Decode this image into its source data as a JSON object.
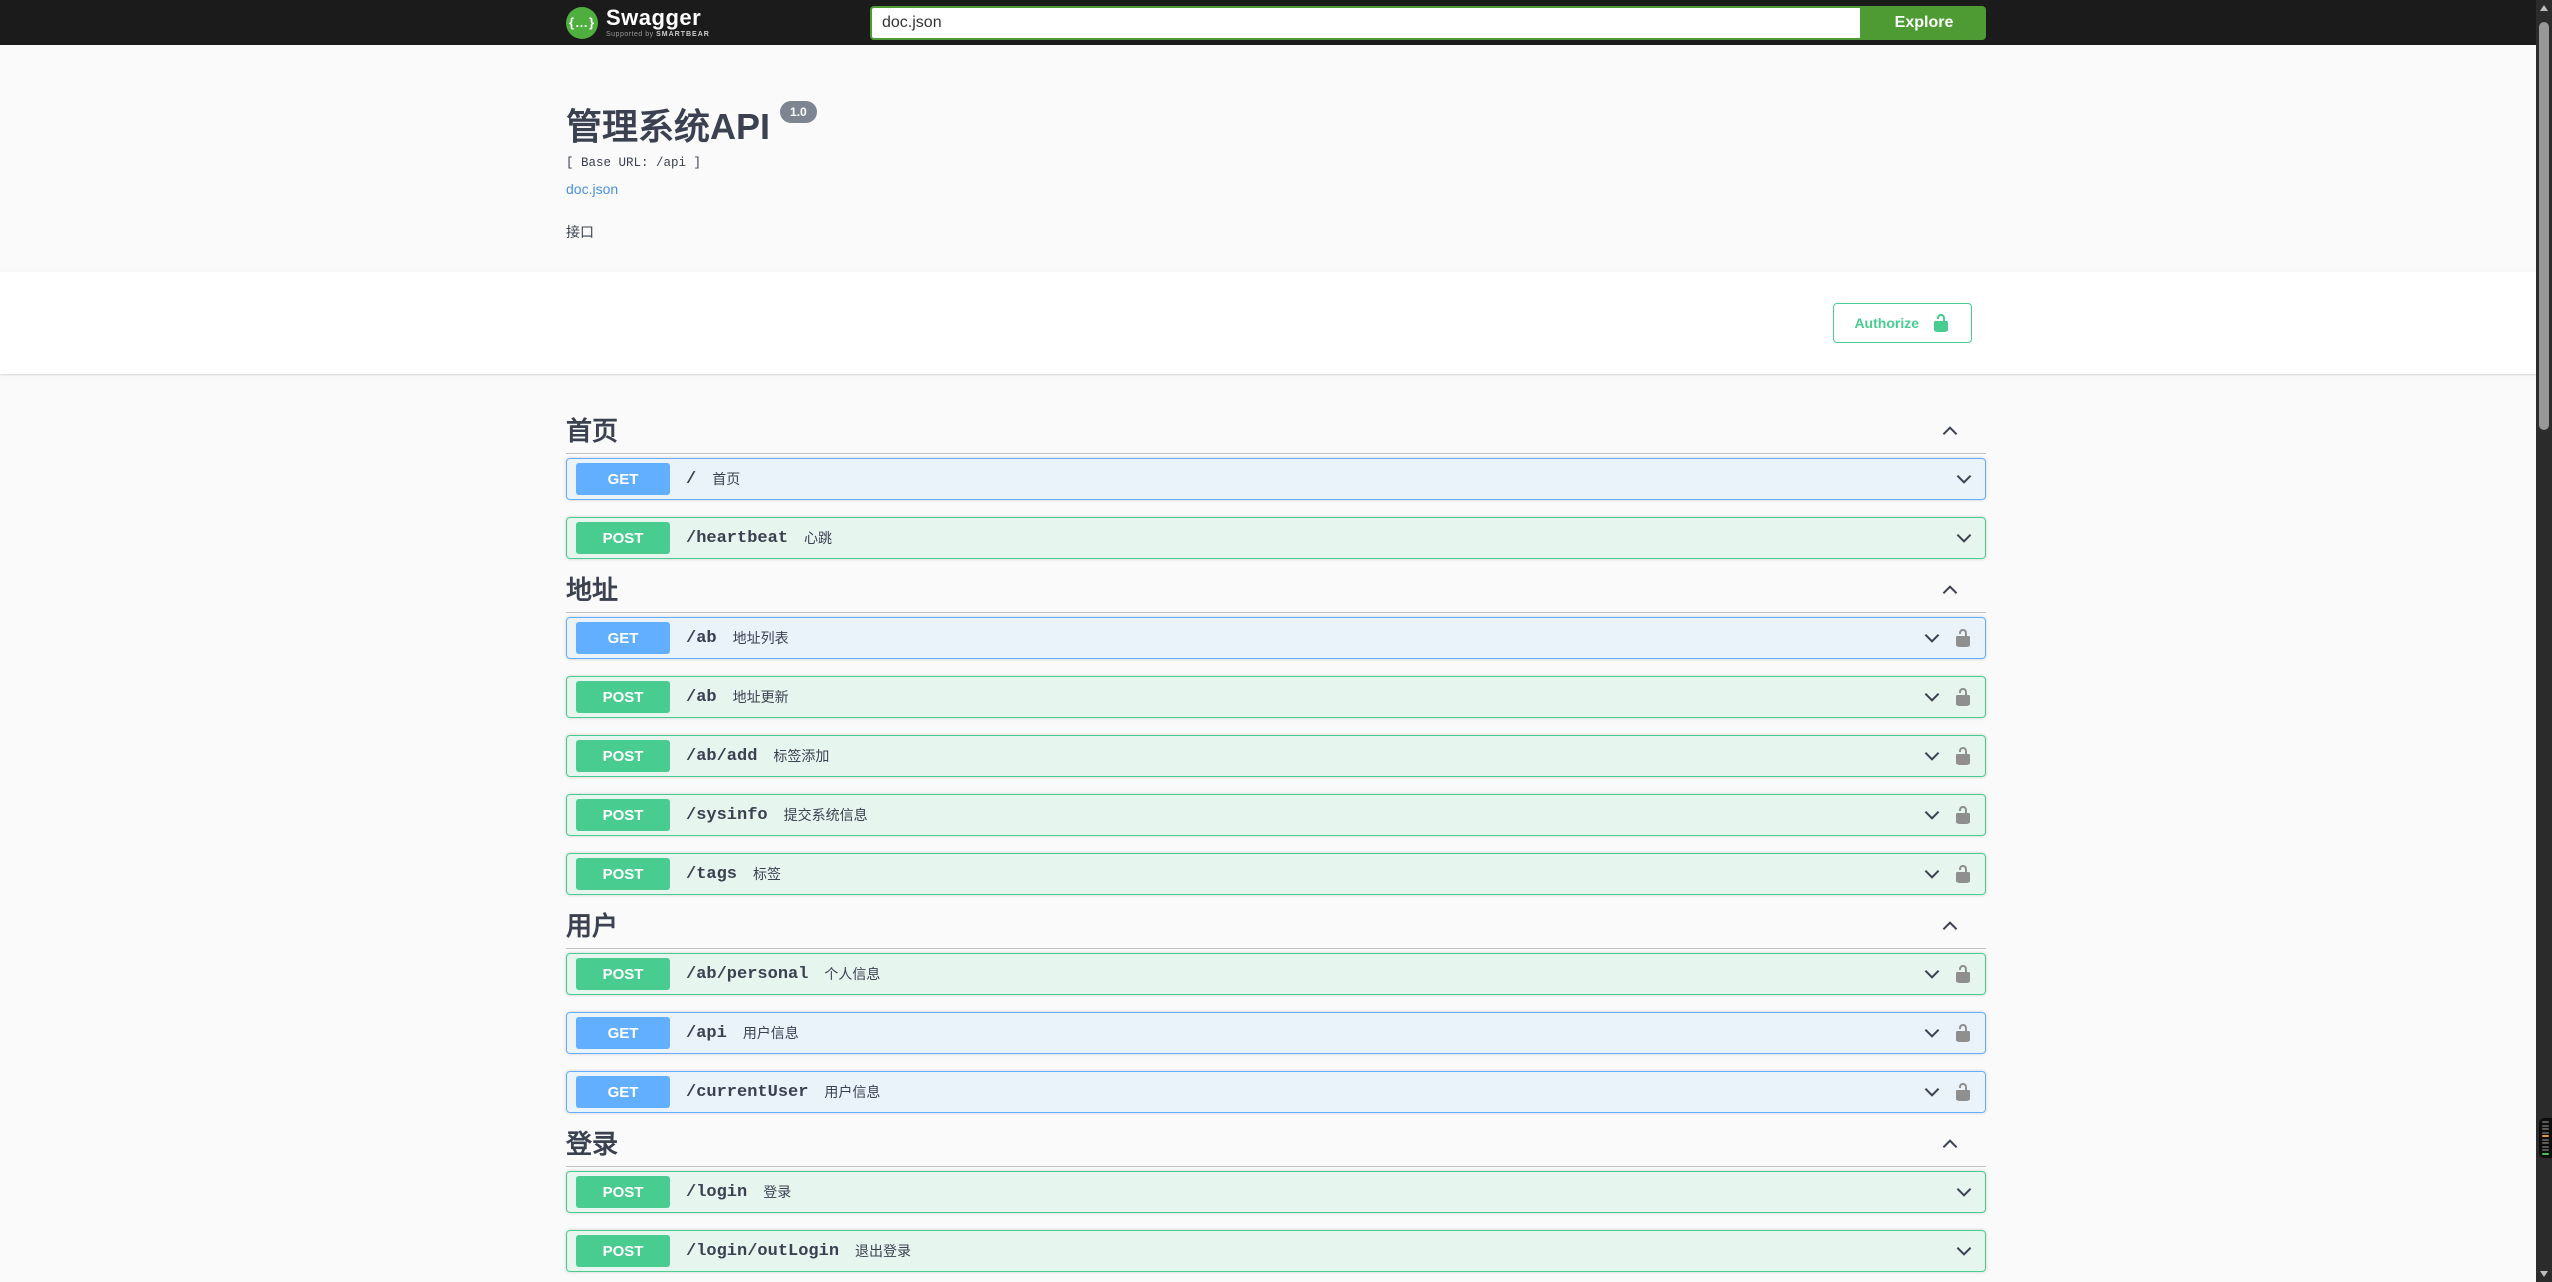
{
  "topbar": {
    "logo_text": "Swagger",
    "logo_tagline_prefix": "Supported by",
    "logo_tagline_brand": "SMARTBEAR",
    "logo_icon_glyph": "{…}",
    "search_value": "doc.json",
    "explore_label": "Explore"
  },
  "info": {
    "title": "管理系统API",
    "version": "1.0",
    "base_url_label": "[ Base URL: /api ]",
    "spec_link": "doc.json",
    "description": "接口"
  },
  "auth": {
    "authorize_label": "Authorize"
  },
  "sections": [
    {
      "title": "首页",
      "expanded": true,
      "operations": [
        {
          "method": "GET",
          "path": "/",
          "summary": "首页",
          "locked": false
        },
        {
          "method": "POST",
          "path": "/heartbeat",
          "summary": "心跳",
          "locked": false
        }
      ]
    },
    {
      "title": "地址",
      "expanded": true,
      "operations": [
        {
          "method": "GET",
          "path": "/ab",
          "summary": "地址列表",
          "locked": true
        },
        {
          "method": "POST",
          "path": "/ab",
          "summary": "地址更新",
          "locked": true
        },
        {
          "method": "POST",
          "path": "/ab/add",
          "summary": "标签添加",
          "locked": true
        },
        {
          "method": "POST",
          "path": "/sysinfo",
          "summary": "提交系统信息",
          "locked": true
        },
        {
          "method": "POST",
          "path": "/tags",
          "summary": "标签",
          "locked": true
        }
      ]
    },
    {
      "title": "用户",
      "expanded": true,
      "operations": [
        {
          "method": "POST",
          "path": "/ab/personal",
          "summary": "个人信息",
          "locked": true
        },
        {
          "method": "GET",
          "path": "/api",
          "summary": "用户信息",
          "locked": true
        },
        {
          "method": "GET",
          "path": "/currentUser",
          "summary": "用户信息",
          "locked": true
        }
      ]
    },
    {
      "title": "登录",
      "expanded": true,
      "operations": [
        {
          "method": "POST",
          "path": "/login",
          "summary": "登录",
          "locked": false
        },
        {
          "method": "POST",
          "path": "/login/outLogin",
          "summary": "退出登录",
          "locked": false
        }
      ]
    }
  ],
  "colors": {
    "get_blue": "#61affe",
    "post_green": "#49cc90",
    "authorize_green": "#49cc90",
    "topbar_green": "#4e9b33",
    "link_blue": "#4990e2",
    "version_badge_gray": "#7d8492",
    "text": "#3b4151",
    "topbar_bg": "#1b1b1b"
  },
  "minimap": {
    "marks": [
      "#5c5c5c",
      "#555555",
      "#5c5c5c",
      "#555555",
      "#e09b3d",
      "#555555",
      "#5c5c5c",
      "#555555",
      "#555555",
      "#44c553"
    ]
  }
}
